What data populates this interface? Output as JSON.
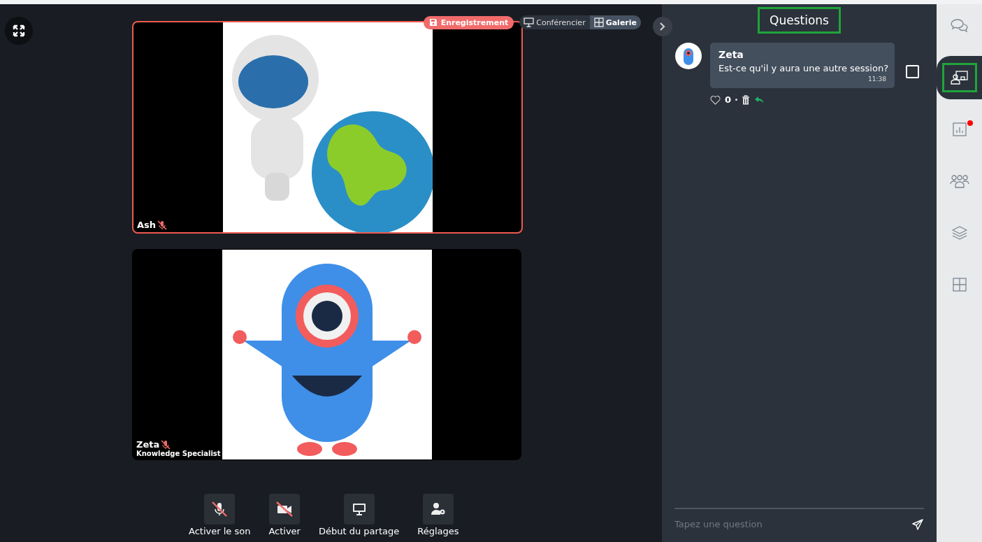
{
  "view_switch": {
    "recording": "Enregistrement",
    "options": [
      {
        "label": "Conférencier",
        "kind": "presenter",
        "selected": false
      },
      {
        "label": "Galerie",
        "kind": "gallery",
        "selected": true
      }
    ]
  },
  "tiles": [
    {
      "name": "Ash",
      "muted": true,
      "active": true,
      "kind": "astronaut"
    },
    {
      "name": "Zeta",
      "role": "Knowledge Specialist",
      "muted": true,
      "active": false,
      "kind": "monster"
    }
  ],
  "controls": [
    {
      "kind": "mic",
      "label": "Activer le son",
      "off": true
    },
    {
      "kind": "camera",
      "label": "Activer",
      "off": true
    },
    {
      "kind": "screen",
      "label": "Début du partage"
    },
    {
      "kind": "settings",
      "label": "Réglages"
    }
  ],
  "panel": {
    "title": "Questions",
    "questions": [
      {
        "author": "Zeta",
        "text": "Est-ce qu'il y aura une autre session?",
        "time": "11:38",
        "likes": "0",
        "checked": false
      }
    ],
    "input": {
      "placeholder": "Tapez une question"
    }
  },
  "sidebar": [
    {
      "kind": "chat",
      "selected": false,
      "badge": false
    },
    {
      "kind": "presenter",
      "selected": true,
      "badge": false
    },
    {
      "kind": "poll",
      "selected": false,
      "badge": true
    },
    {
      "kind": "people",
      "selected": false,
      "badge": false
    },
    {
      "kind": "layers",
      "selected": false,
      "badge": false
    },
    {
      "kind": "grid",
      "selected": false,
      "badge": false
    }
  ]
}
